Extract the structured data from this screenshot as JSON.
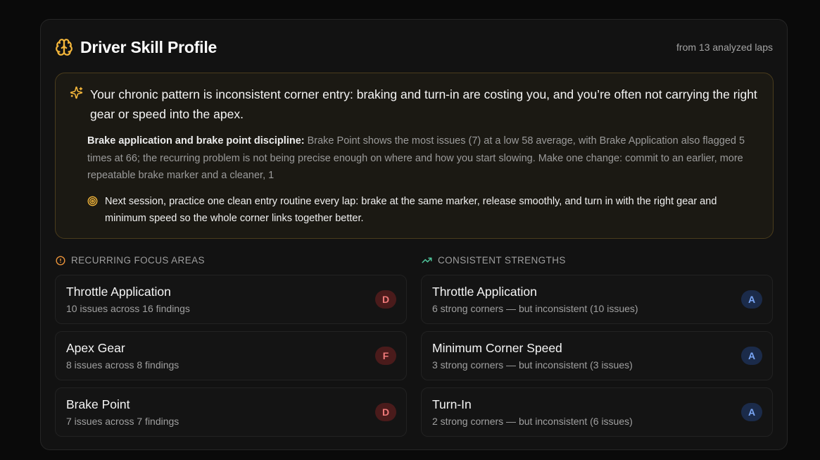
{
  "header": {
    "title": "Driver Skill Profile",
    "subtitle": "from 13 analyzed laps"
  },
  "insight": {
    "headline": "Your chronic pattern is inconsistent corner entry: braking and turn-in are costing you, and you’re often not carrying the right gear or speed into the apex.",
    "detail_label": "Brake application and brake point discipline:",
    "detail_body": " Brake Point shows the most issues (7) at a low 58 average, with Brake Application also flagged 5 times at 66; the recurring problem is not being precise enough on where and how you start slowing. Make one change: commit to an earlier, more repeatable brake marker and a cleaner, 1",
    "next_step": "Next session, practice one clean entry routine every lap: brake at the same marker, release smoothly, and turn in with the right gear and minimum speed so the whole corner links together better."
  },
  "focus": {
    "label": "RECURRING FOCUS AREAS",
    "items": [
      {
        "name": "Throttle Application",
        "desc": "10 issues across 16 findings",
        "grade": "D"
      },
      {
        "name": "Apex Gear",
        "desc": "8 issues across 8 findings",
        "grade": "F"
      },
      {
        "name": "Brake Point",
        "desc": "7 issues across 7 findings",
        "grade": "D"
      }
    ]
  },
  "strengths": {
    "label": "CONSISTENT STRENGTHS",
    "items": [
      {
        "name": "Throttle Application",
        "desc": "6 strong corners — but inconsistent (10 issues)",
        "grade": "A"
      },
      {
        "name": "Minimum Corner Speed",
        "desc": "3 strong corners — but inconsistent (3 issues)",
        "grade": "A"
      },
      {
        "name": "Turn-In",
        "desc": "2 strong corners — but inconsistent (6 issues)",
        "grade": "A"
      }
    ]
  },
  "colors": {
    "accent_gold": "#f5b73b",
    "issue_orange": "#e8923a",
    "strength_green": "#4fc39a",
    "grade_bad": "#f07a7a",
    "grade_good": "#7aa6f5"
  },
  "icons": {
    "header": "brain-icon",
    "headline": "sparkles-icon",
    "next_step": "target-icon",
    "focus": "alert-circle-icon",
    "strengths": "trending-up-icon"
  }
}
